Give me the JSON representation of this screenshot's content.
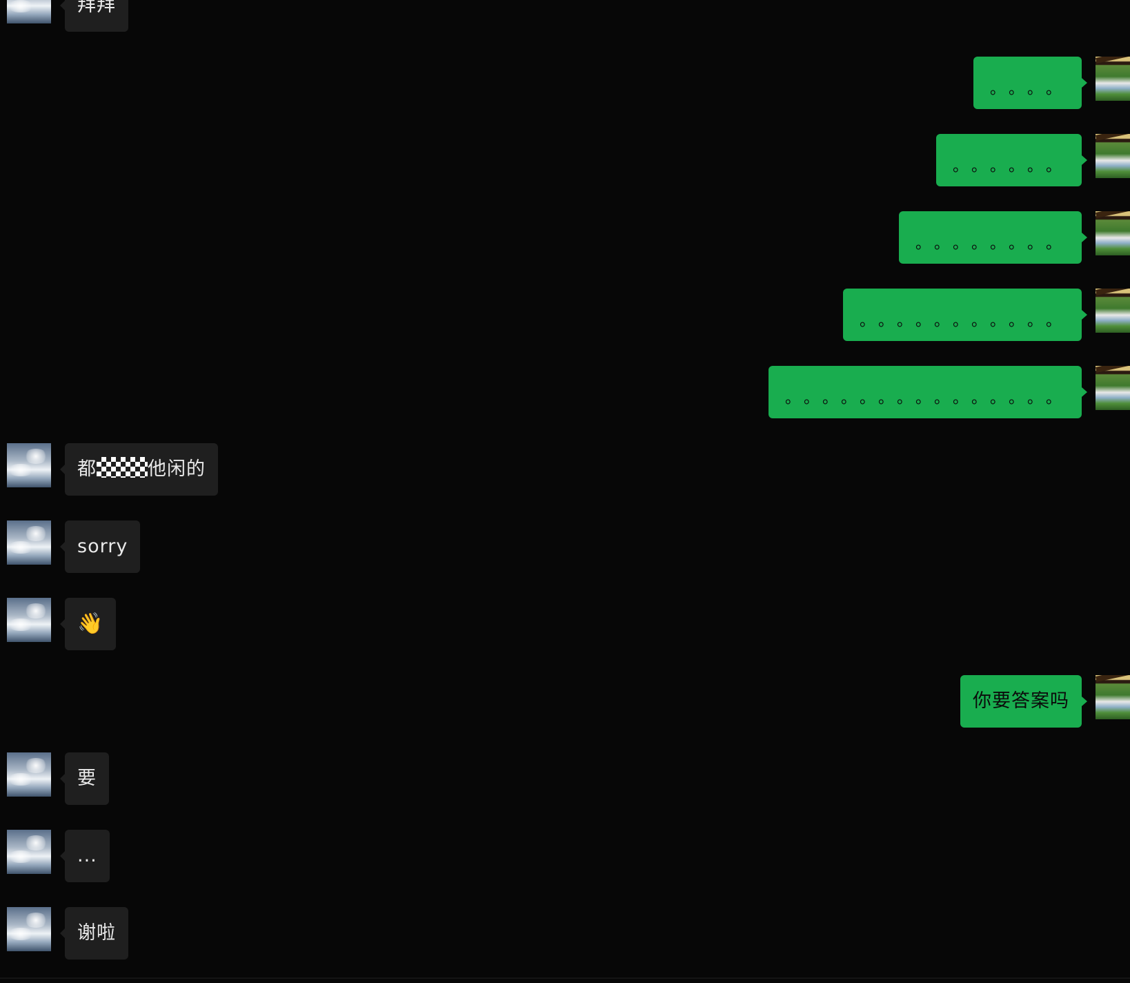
{
  "messages": [
    {
      "side": "in",
      "text": "拜拜"
    },
    {
      "side": "out",
      "text": "。。。。"
    },
    {
      "side": "out",
      "text": "。。。。。。"
    },
    {
      "side": "out",
      "text": "。。。。。。。。"
    },
    {
      "side": "out",
      "text": "。。。。。。。。。。。"
    },
    {
      "side": "out",
      "text": "。。。。。。。。。。。。。。。"
    },
    {
      "side": "in",
      "text_before": "都",
      "text_after": "他闲的"
    },
    {
      "side": "in",
      "text": "sorry"
    },
    {
      "side": "in",
      "text": "👋"
    },
    {
      "side": "out",
      "text": "你要答案吗"
    },
    {
      "side": "in",
      "text": "要"
    },
    {
      "side": "in",
      "text": "..."
    },
    {
      "side": "in",
      "text": "谢啦"
    }
  ],
  "colors": {
    "background": "#070707",
    "incoming_bubble": "#1f1f1f",
    "outgoing_bubble": "#19ad4f",
    "incoming_text": "#e9e9e9",
    "outgoing_text": "#0b0b0b"
  },
  "icons": {
    "contact_avatar": "sky-clouds-avatar",
    "own_avatar": "landscape-avatar"
  }
}
